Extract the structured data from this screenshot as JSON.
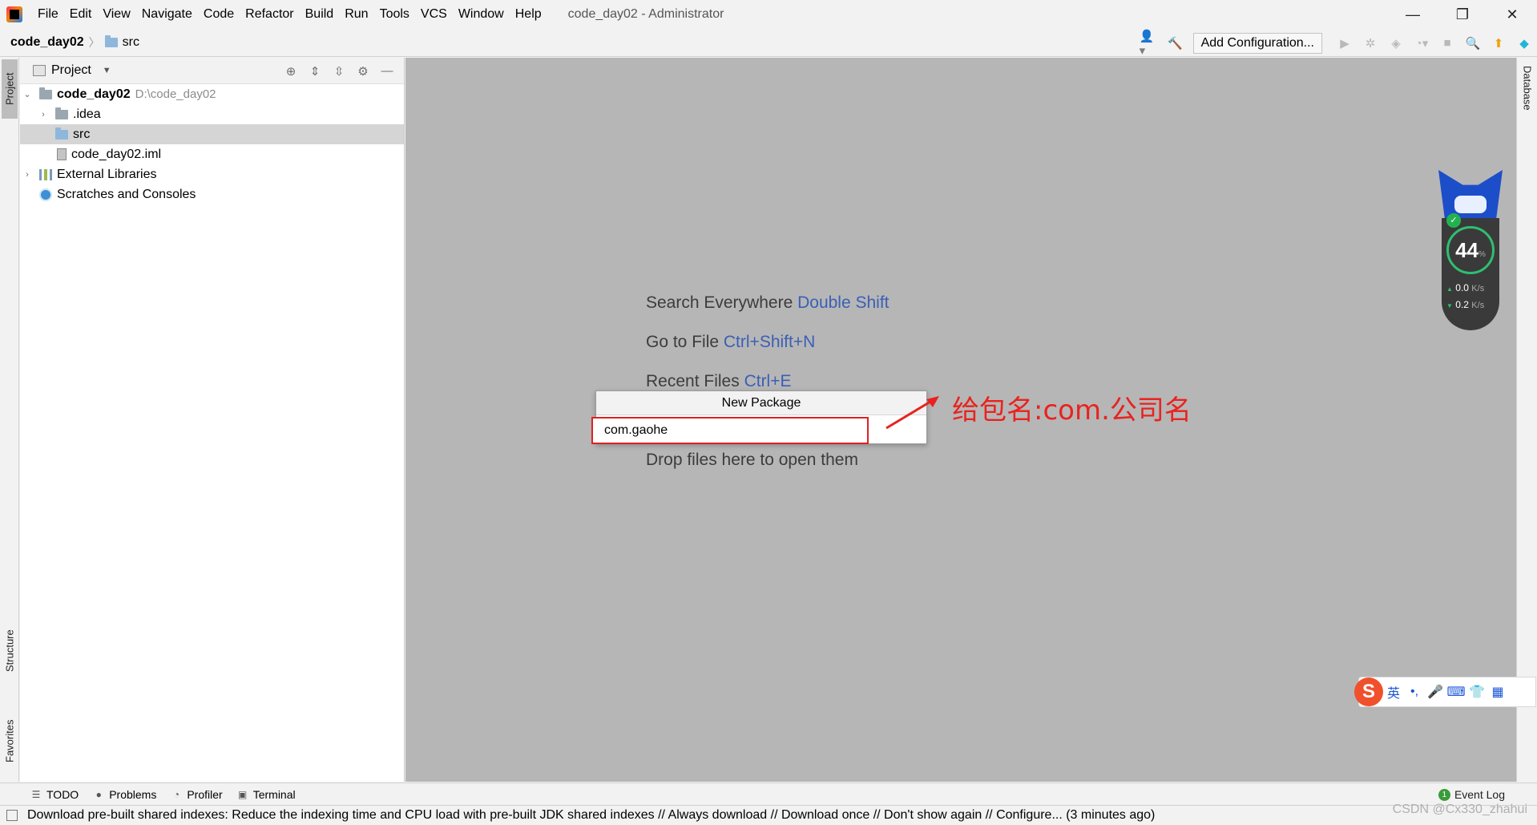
{
  "titlebar": {
    "menu": [
      "File",
      "Edit",
      "View",
      "Navigate",
      "Code",
      "Refactor",
      "Build",
      "Run",
      "Tools",
      "VCS",
      "Window",
      "Help"
    ],
    "window_title": "code_day02 - Administrator",
    "controls": [
      "—",
      "❐",
      "✕"
    ]
  },
  "navbar": {
    "breadcrumb_root": "code_day02",
    "breadcrumb_child": "src",
    "add_configuration": "Add Configuration..."
  },
  "tool_strips": {
    "left": [
      "Project",
      "Structure",
      "Favorites"
    ],
    "right": [
      "Database"
    ]
  },
  "project_panel": {
    "title": "Project",
    "tree": [
      {
        "label": "code_day02",
        "path": "D:\\code_day02",
        "icon": "module-folder-icon",
        "twisty": "v",
        "bold": true
      },
      {
        "label": ".idea",
        "icon": "folder-icon",
        "twisty": ">"
      },
      {
        "label": "src",
        "icon": "source-folder-icon",
        "twisty": "",
        "selected": true
      },
      {
        "label": "code_day02.iml",
        "icon": "iml-file-icon",
        "twisty": ""
      },
      {
        "label": "External Libraries",
        "icon": "library-icon",
        "twisty": ">"
      },
      {
        "label": "Scratches and Consoles",
        "icon": "scratch-icon",
        "twisty": ""
      }
    ]
  },
  "editor_hints": [
    {
      "text": "Search Everywhere",
      "key": "Double Shift"
    },
    {
      "text": "Go to File",
      "key": "Ctrl+Shift+N"
    },
    {
      "text": "Recent Files",
      "key": "Ctrl+E"
    },
    {
      "text": "Drop files here to open them",
      "key": ""
    }
  ],
  "new_package_dialog": {
    "title": "New Package",
    "input_value": "com.gaohe"
  },
  "annotation": {
    "text": "给包名:com.公司名",
    "color": "#e8231f"
  },
  "net_widget": {
    "percent": "44",
    "percent_unit": "%",
    "up_rate": "0.0",
    "down_rate": "0.2",
    "rate_unit": "K/s"
  },
  "ime_toolbar": {
    "logo": "S",
    "items": [
      "英",
      "•,",
      "🎤",
      "⌨",
      "👕",
      "▦"
    ]
  },
  "bottom_bar": {
    "tabs": [
      "TODO",
      "Problems",
      "Profiler",
      "Terminal"
    ],
    "event_log": "Event Log",
    "event_count": "1"
  },
  "status_bar": {
    "message": "Download pre-built shared indexes: Reduce the indexing time and CPU load with pre-built JDK shared indexes // Always download // Download once // Don't show again // Configure... (3 minutes ago)"
  },
  "watermark": "CSDN @Cx330_zhahui"
}
